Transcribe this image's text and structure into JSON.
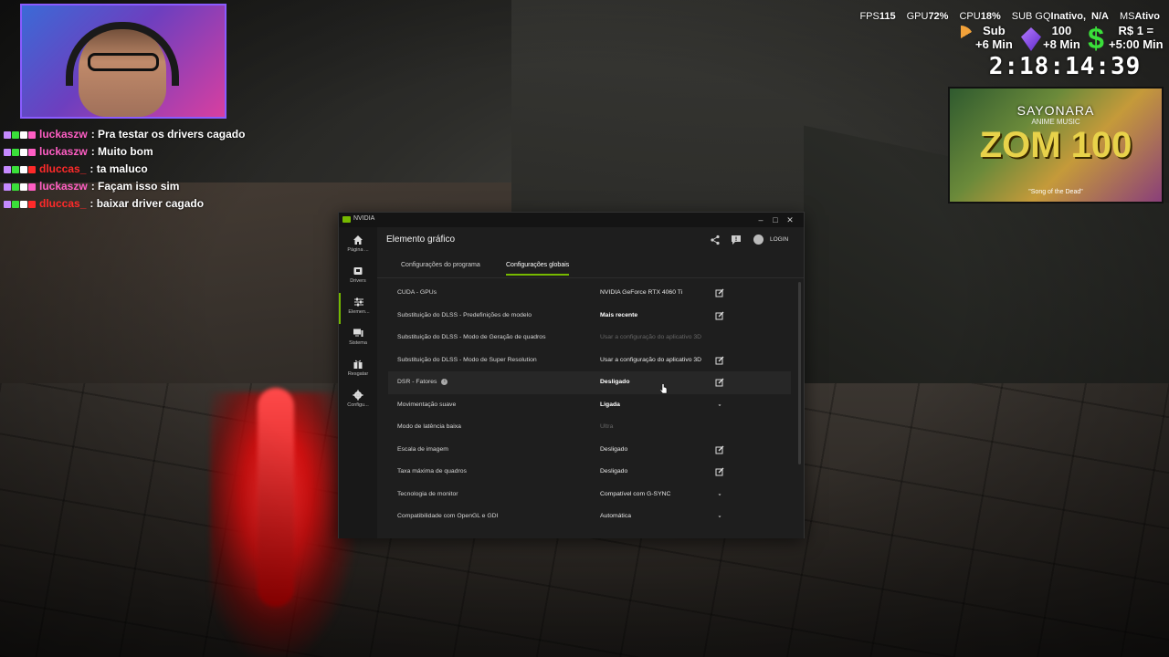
{
  "stream": {
    "stats": [
      {
        "label": "FPS",
        "value": "115"
      },
      {
        "label": "GPU",
        "value": "72%"
      },
      {
        "label": "CPU",
        "value": "18%"
      },
      {
        "label": "SUB GQ",
        "value": "Inativo,"
      },
      {
        "label": "",
        "value": "N/A"
      },
      {
        "label": "MS",
        "value": "Ativo"
      }
    ],
    "counters": {
      "sub_line1": "Sub",
      "sub_line2": "+6 Min",
      "gem_line1": "100",
      "gem_line2": "+8 Min",
      "cash_line1": "R$ 1 =",
      "cash_line2": "+5:00 Min"
    },
    "timer": "2:18:14:39",
    "music": {
      "title": "SAYONARA",
      "subtitle": "ANIME MUSIC",
      "big_text": "ZOM 100",
      "song": "\"Song of the Dead\""
    }
  },
  "chat": [
    {
      "user": "luckaszw",
      "color": "#ff5ec4",
      "message": ": Pra testar os drivers cagado"
    },
    {
      "user": "luckaszw",
      "color": "#ff5ec4",
      "message": ": Muito bom"
    },
    {
      "user": "dluccas_",
      "color": "#ff2a2a",
      "message": ": ta maluco"
    },
    {
      "user": "luckaszw",
      "color": "#ff5ec4",
      "message": ": Façam isso sim"
    },
    {
      "user": "dluccas_",
      "color": "#ff2a2a",
      "message": ": baixar driver cagado"
    }
  ],
  "app": {
    "window_title": "NVIDIA",
    "accent": "#76b900",
    "sidebar": [
      {
        "label": "Página ...",
        "icon": "home-icon"
      },
      {
        "label": "Drivers",
        "icon": "drivers-icon"
      },
      {
        "label": "Elemen...",
        "icon": "sliders-icon",
        "active": true
      },
      {
        "label": "Sistema",
        "icon": "system-icon"
      },
      {
        "label": "Resgatar",
        "icon": "gift-icon"
      },
      {
        "label": "Configu...",
        "icon": "gear-icon"
      }
    ],
    "page_title": "Elemento gráfico",
    "login_label": "LOGIN",
    "tabs": [
      "Configurações do programa",
      "Configurações globais"
    ],
    "active_tab": 1,
    "settings": [
      {
        "name": "CUDA - GPUs",
        "value": "NVIDIA GeForce RTX 4060 Ti",
        "style": "normal",
        "control": "edit"
      },
      {
        "name": "Substituição do DLSS - Predefinições de modelo",
        "value": "Mais recente",
        "style": "bold",
        "control": "edit"
      },
      {
        "name": "Substituição do DLSS - Modo de Geração de quadros",
        "value": "Usar a configuração do aplicativo 3D",
        "style": "dim",
        "control": "none"
      },
      {
        "name": "Substituição do DLSS - Modo de Super Resolution",
        "value": "Usar a configuração do aplicativo 3D",
        "style": "normal",
        "control": "edit"
      },
      {
        "name": "DSR - Fatores",
        "value": "Desligado",
        "style": "bold",
        "control": "edit",
        "info": true,
        "highlight": true
      },
      {
        "name": "Movimentação suave",
        "value": "Ligada",
        "style": "bold",
        "control": "dropdown"
      },
      {
        "name": "Modo de latência baixa",
        "value": "Ultra",
        "style": "dim",
        "control": "none"
      },
      {
        "name": "Escala de imagem",
        "value": "Desligado",
        "style": "normal",
        "control": "edit"
      },
      {
        "name": "Taxa máxima de quadros",
        "value": "Desligado",
        "style": "normal",
        "control": "edit"
      },
      {
        "name": "Tecnologia de monitor",
        "value": "Compatível com G-SYNC",
        "style": "normal",
        "control": "dropdown"
      },
      {
        "name": "Compatibilidade com OpenGL e GDI",
        "value": "Automática",
        "style": "normal",
        "control": "dropdown"
      }
    ]
  }
}
